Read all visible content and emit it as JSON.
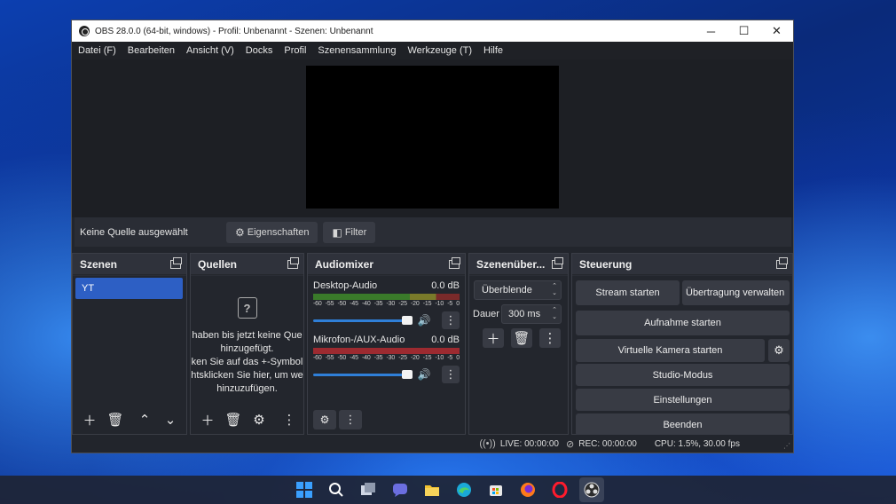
{
  "window": {
    "title": "OBS 28.0.0 (64-bit, windows) - Profil: Unbenannt - Szenen: Unbenannt",
    "controls": {
      "minimize": "─",
      "maximize": "☐",
      "close": "✕"
    }
  },
  "menu": [
    "Datei (F)",
    "Bearbeiten",
    "Ansicht (V)",
    "Docks",
    "Profil",
    "Szenensammlung",
    "Werkzeuge (T)",
    "Hilfe"
  ],
  "source_bar": {
    "no_source": "Keine Quelle ausgewählt",
    "properties": "Eigenschaften",
    "filter": "Filter"
  },
  "docks": {
    "scenes": {
      "title": "Szenen",
      "items": [
        "YT"
      ]
    },
    "sources": {
      "title": "Quellen",
      "empty_lines": [
        "haben bis jetzt keine Que",
        "hinzugefügt.",
        "ken Sie auf das +-Symbol",
        "htsklicken Sie hier, um we",
        "hinzuzufügen."
      ]
    },
    "mixer": {
      "title": "Audiomixer",
      "channels": [
        {
          "name": "Desktop-Audio",
          "level": "0.0 dB",
          "volume": 1.0,
          "muted": false
        },
        {
          "name": "Mikrofon-/AUX-Audio",
          "level": "0.0 dB",
          "volume": 1.0,
          "muted": false
        }
      ],
      "scale": [
        "-60",
        "-55",
        "-50",
        "-45",
        "-40",
        "-35",
        "-30",
        "-25",
        "-20",
        "-15",
        "-10",
        "-5",
        "0"
      ]
    },
    "transitions": {
      "title": "Szenenüber...",
      "selected": "Überblende",
      "duration_label": "Dauer",
      "duration_value": "300 ms"
    },
    "controls": {
      "title": "Steuerung",
      "stream": "Stream starten",
      "transmission": "Übertragung verwalten",
      "record": "Aufnahme starten",
      "virtual_cam": "Virtuelle Kamera starten",
      "studio": "Studio-Modus",
      "settings": "Einstellungen",
      "exit": "Beenden"
    }
  },
  "status": {
    "live": "LIVE: 00:00:00",
    "rec": "REC: 00:00:00",
    "cpu": "CPU: 1.5%, 30.00 fps"
  },
  "taskbar": [
    "windows-start-icon",
    "search-icon",
    "task-view-icon",
    "teams-chat-icon",
    "file-explorer-icon",
    "edge-icon",
    "store-icon",
    "firefox-icon",
    "opera-icon",
    "obs-icon"
  ]
}
